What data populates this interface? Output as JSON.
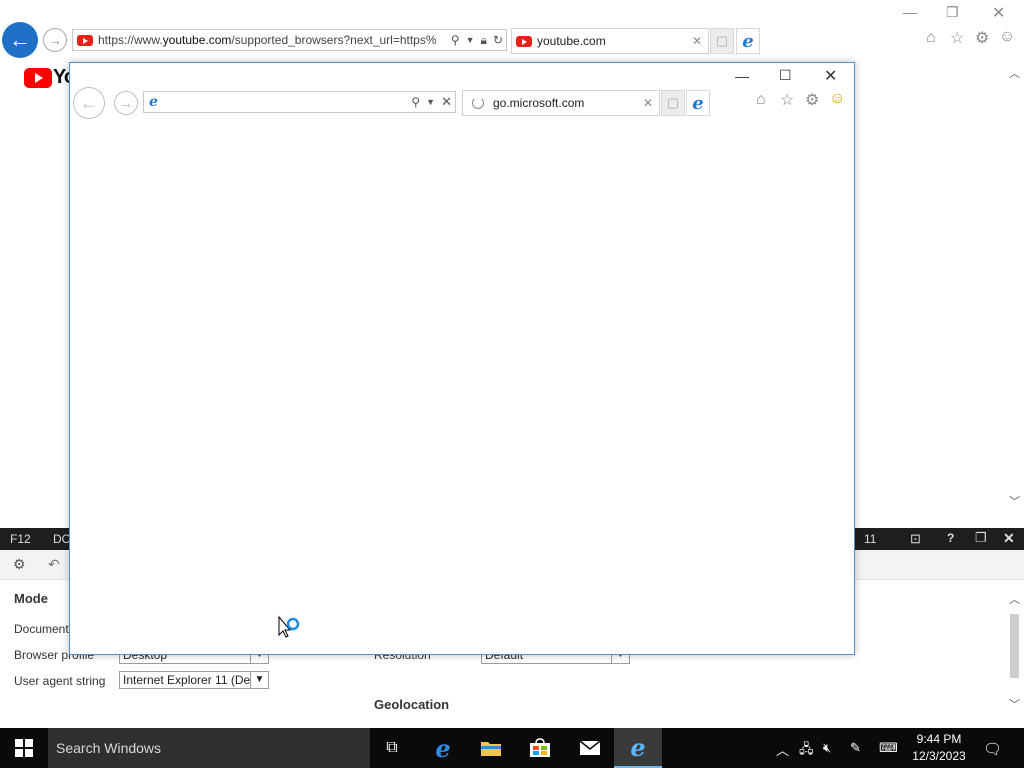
{
  "background_browser": {
    "address_url_prefix": "https://www.",
    "address_url_domain": "youtube.com",
    "address_url_rest": "/supported_browsers?next_url=https%",
    "tab_title": "youtube.com",
    "page_logo_text": "Yo"
  },
  "devtools": {
    "f12_label": "F12",
    "dom_tab_label": "DO",
    "emulation_version": "11",
    "section_mode": "Mode",
    "document_mode_label": "Document",
    "browser_profile_label": "Browser profile",
    "browser_profile_value": "Desktop",
    "user_agent_label": "User agent string",
    "user_agent_value": "Internet Explorer 11 (De",
    "resolution_label": "Resolution",
    "resolution_value": "Default",
    "geolocation_heading": "Geolocation"
  },
  "popup_browser": {
    "address_value": "",
    "tab_title": "go.microsoft.com"
  },
  "taskbar": {
    "search_placeholder": "Search Windows",
    "time": "9:44 PM",
    "date": "12/3/2023"
  },
  "colors": {
    "accent_blue": "#1f6fc6",
    "youtube_red": "#ff0000",
    "taskbar_bg": "#0a0a0a",
    "devtools_bar": "#1e1e1e",
    "popup_border": "#4f8fd9"
  }
}
